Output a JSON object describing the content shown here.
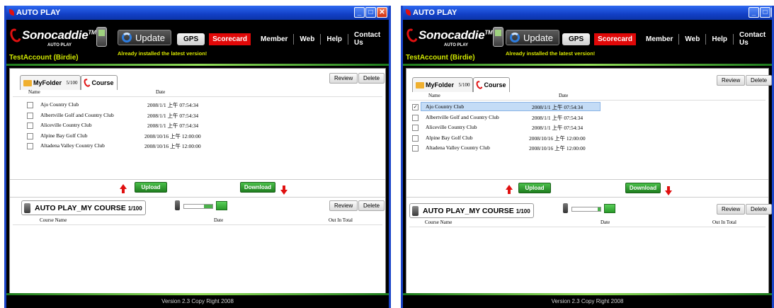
{
  "panels": [
    {
      "title": "AUTO PLAY",
      "brand": "Sonocaddie",
      "brand_mark": "TM",
      "brand_sub": "AUTO PLAY",
      "update_label": "Update",
      "status": "Already installed the latest version!",
      "account": "TestAccount (Birdie)",
      "nav": {
        "gps": "GPS",
        "scorecard": "Scorecard",
        "member": "Member",
        "web": "Web",
        "help": "Help",
        "contact": "Contact Us"
      },
      "tabs": {
        "folder": "MyFolder",
        "folder_count": "5/100",
        "course": "Course"
      },
      "review": "Review",
      "delete": "Delete",
      "list_headers": {
        "name": "Name",
        "date": "Date"
      },
      "courses": [
        {
          "name": "Ajo Country Club",
          "date": "2008/1/1 上午 07:54:34",
          "checked": false
        },
        {
          "name": "Albertville Golf and Country Club",
          "date": "2008/1/1 上午 07:54:34",
          "checked": false
        },
        {
          "name": "Aliceville Country Club",
          "date": "2008/1/1 上午 07:54:34",
          "checked": false
        },
        {
          "name": "Alpine Bay Golf Club",
          "date": "2008/10/16 上午 12:00:00",
          "checked": false
        },
        {
          "name": "Altadena Valley Country Club",
          "date": "2008/10/16 上午 12:00:00",
          "checked": false
        }
      ],
      "upload": "Upload",
      "download": "Download",
      "device_tab": "AUTO PLAY_MY COURSE",
      "device_count": "1/100",
      "device_headers": {
        "course_name": "Course Name",
        "date": "Date",
        "out_in_total": "Out In Total"
      },
      "sync_progress": 0.3,
      "footer": "Version 2.3 Copy Right 2008"
    },
    {
      "title": "AUTO PLAY",
      "brand": "Sonocaddie",
      "brand_mark": "TM",
      "brand_sub": "AUTO PLAY",
      "update_label": "Update",
      "status": "Already installed the latest version!",
      "account": "TestAccount (Birdie)",
      "nav": {
        "gps": "GPS",
        "scorecard": "Scorecard",
        "member": "Member",
        "web": "Web",
        "help": "Help",
        "contact": "Contact Us"
      },
      "tabs": {
        "folder": "MyFolder",
        "folder_count": "5/100",
        "course": "Course"
      },
      "review": "Review",
      "delete": "Delete",
      "list_headers": {
        "name": "Name",
        "date": "Date"
      },
      "courses": [
        {
          "name": "Ajo Country Club",
          "date": "2008/1/1 上午 07:54:34",
          "checked": true
        },
        {
          "name": "Albertville Golf and Country Club",
          "date": "2008/1/1 上午 07:54:34",
          "checked": false
        },
        {
          "name": "Aliceville Country Club",
          "date": "2008/1/1 上午 07:54:34",
          "checked": false
        },
        {
          "name": "Alpine Bay Golf Club",
          "date": "2008/10/16 上午 12:00:00",
          "checked": false
        },
        {
          "name": "Altadena Valley Country Club",
          "date": "2008/10/16 上午 12:00:00",
          "checked": false
        }
      ],
      "upload": "Upload",
      "download": "Download",
      "device_tab": "AUTO PLAY_MY COURSE",
      "device_count": "1/100",
      "device_headers": {
        "course_name": "Course Name",
        "date": "Date",
        "out_in_total": "Out In Total"
      },
      "sync_progress": 0.1,
      "footer": "Version 2.3 Copy Right 2008"
    }
  ]
}
